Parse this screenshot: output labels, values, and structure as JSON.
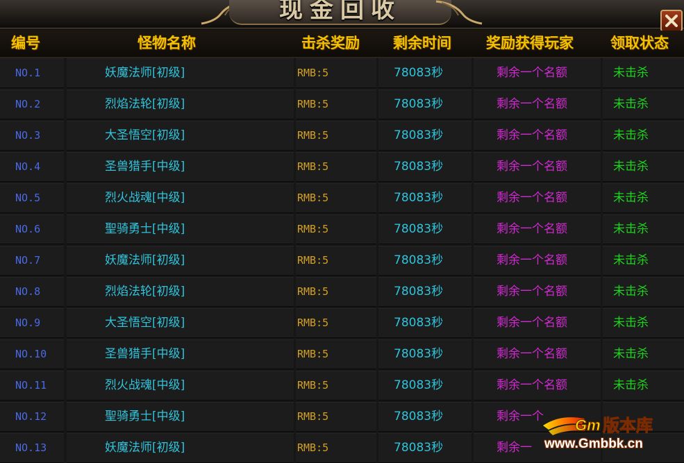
{
  "window": {
    "title": "现金回收",
    "close_icon": "close-icon"
  },
  "table": {
    "headers": {
      "no": "编号",
      "monster_name": "怪物名称",
      "kill_reward": "击杀奖励",
      "remaining_time": "剩余时间",
      "reward_player": "奖励获得玩家",
      "claim_status": "领取状态"
    },
    "rows": [
      {
        "no": "NO.1",
        "name": "妖魔法师[初级]",
        "reward": "RMB:5",
        "time": "78083秒",
        "player": "剩余一个名额",
        "status": "未击杀"
      },
      {
        "no": "NO.2",
        "name": "烈焰法轮[初级]",
        "reward": "RMB:5",
        "time": "78083秒",
        "player": "剩余一个名额",
        "status": "未击杀"
      },
      {
        "no": "NO.3",
        "name": "大圣悟空[初级]",
        "reward": "RMB:5",
        "time": "78083秒",
        "player": "剩余一个名额",
        "status": "未击杀"
      },
      {
        "no": "NO.4",
        "name": "圣兽猎手[中级]",
        "reward": "RMB:5",
        "time": "78083秒",
        "player": "剩余一个名额",
        "status": "未击杀"
      },
      {
        "no": "NO.5",
        "name": "烈火战魂[中级]",
        "reward": "RMB:5",
        "time": "78083秒",
        "player": "剩余一个名额",
        "status": "未击杀"
      },
      {
        "no": "NO.6",
        "name": "聖骑勇士[中级]",
        "reward": "RMB:5",
        "time": "78083秒",
        "player": "剩余一个名额",
        "status": "未击杀"
      },
      {
        "no": "NO.7",
        "name": "妖魔法师[初级]",
        "reward": "RMB:5",
        "time": "78083秒",
        "player": "剩余一个名额",
        "status": "未击杀"
      },
      {
        "no": "NO.8",
        "name": "烈焰法轮[初级]",
        "reward": "RMB:5",
        "time": "78083秒",
        "player": "剩余一个名额",
        "status": "未击杀"
      },
      {
        "no": "NO.9",
        "name": "大圣悟空[初级]",
        "reward": "RMB:5",
        "time": "78083秒",
        "player": "剩余一个名额",
        "status": "未击杀"
      },
      {
        "no": "NO.10",
        "name": "圣兽猎手[中级]",
        "reward": "RMB:5",
        "time": "78083秒",
        "player": "剩余一个名额",
        "status": "未击杀"
      },
      {
        "no": "NO.11",
        "name": "烈火战魂[中级]",
        "reward": "RMB:5",
        "time": "78083秒",
        "player": "剩余一个名额",
        "status": "未击杀"
      },
      {
        "no": "NO.12",
        "name": "聖骑勇士[中级]",
        "reward": "RMB:5",
        "time": "78083秒",
        "player": "剩余一个",
        "status": ""
      },
      {
        "no": "NO.13",
        "name": "妖魔法师[初级]",
        "reward": "RMB:5",
        "time": "78083秒",
        "player": "剩余一",
        "status": ""
      }
    ]
  },
  "watermark": {
    "logo_text": "GM版本库",
    "url": "www.Gmbbk.cn"
  },
  "colors": {
    "header_text": "#f2c200",
    "row_number": "#4a6ae8",
    "monster_name": "#2fc4dc",
    "reward": "#d4a020",
    "time": "#2fc4dc",
    "player": "#d22ad2",
    "status": "#1fd41f"
  }
}
